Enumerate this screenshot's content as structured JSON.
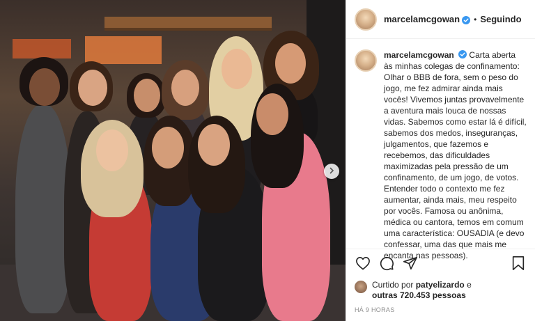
{
  "post": {
    "image_alt": "Group photo",
    "next_icon": "chevron-right-icon"
  },
  "header": {
    "username": "marcelamcgowan",
    "separator": "•",
    "follow_status": "Seguindo"
  },
  "caption": {
    "username": "marcelamcgowan",
    "text": "Carta aberta às minhas colegas de confinamento: Olhar o BBB de fora, sem o peso do jogo, me fez admirar ainda mais vocês! Vivemos juntas provavelmente a aventura mais louca de nossas vidas. Sabemos como estar lá é difícil, sabemos dos medos, inseguranças, julgamentos, que fazemos e recebemos, das dificuldades maximizadas pela pressão de um confinamento, de um jogo, de votos. Entender todo o contexto me fez aumentar, ainda mais, meu respeito por vocês. Famosa ou anônima, médica ou cantora, temos em comum uma característica: OUSADIA (e devo confessar, uma das que mais me encanta nas pessoas)."
  },
  "actions": {
    "icons": [
      "heart-icon",
      "comment-icon",
      "share-icon",
      "bookmark-icon"
    ]
  },
  "likes": {
    "prefix": "Curtido por ",
    "user": "patyelizardo",
    "middle": " e",
    "others": "outras 720.453 pessoas"
  },
  "timestamp": "HÁ 9 HORAS",
  "colors": {
    "verified": "#3897f0",
    "text": "#262626",
    "muted": "#8e8e8e",
    "border": "#efefef"
  }
}
